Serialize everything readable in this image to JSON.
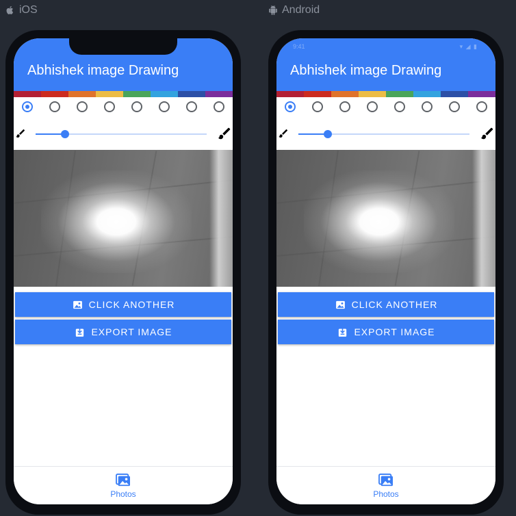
{
  "platforms": [
    {
      "label": "iOS",
      "icon": "apple-icon",
      "app_title": "Abhishek image Drawing",
      "status_left": "",
      "status_right": ""
    },
    {
      "label": "Android",
      "icon": "android-icon",
      "app_title": "Abhishek image Drawing",
      "status_left": "9:41",
      "status_right": "▾ ◢ ▮"
    }
  ],
  "palette": [
    "#b32034",
    "#cc2b1f",
    "#e0732b",
    "#ecbc45",
    "#4aa55a",
    "#33a3df",
    "#2c4fa6",
    "#7b2d9c"
  ],
  "radio_count": 8,
  "selected_radio": 0,
  "brush_size_fraction": 0.17,
  "buttons": {
    "click_another": "CLICK ANOTHER",
    "export_image": "EXPORT IMAGE"
  },
  "nav": {
    "photos": "Photos"
  },
  "colors": {
    "primary": "#3a7ef6",
    "background": "#252a33",
    "frame": "#0b0d12"
  }
}
